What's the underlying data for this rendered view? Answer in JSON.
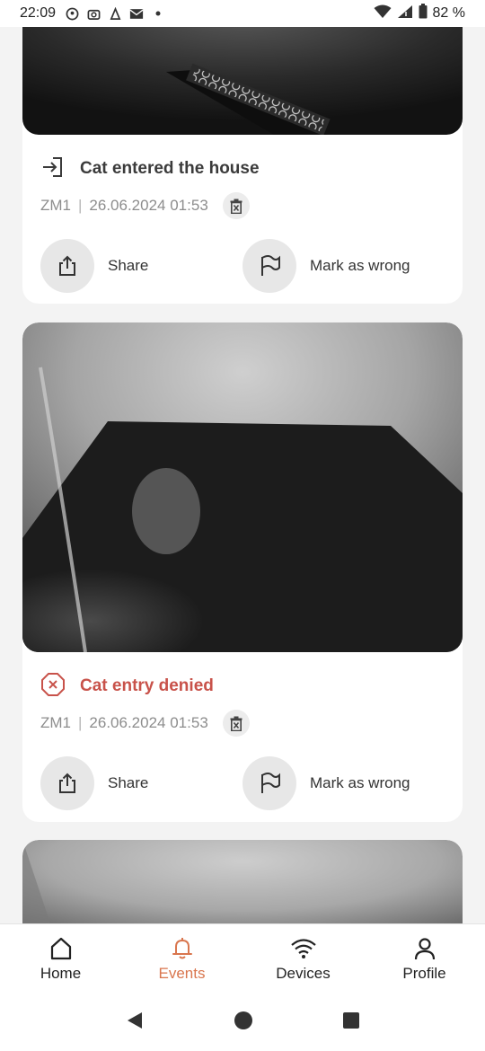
{
  "status_bar": {
    "time": "22:09",
    "battery": "82 %",
    "icons": [
      "location-icon",
      "camera-icon",
      "app-icon",
      "mail-icon",
      "dot-icon",
      "wifi-icon",
      "signal-icon",
      "battery-icon"
    ]
  },
  "events": [
    {
      "title": "Cat entered the house",
      "type": "entered",
      "device": "ZM1",
      "separator": "|",
      "datetime": "26.06.2024 01:53",
      "share_label": "Share",
      "mark_label": "Mark as wrong"
    },
    {
      "title": "Cat entry denied",
      "type": "denied",
      "device": "ZM1",
      "separator": "|",
      "datetime": "26.06.2024 01:53",
      "share_label": "Share",
      "mark_label": "Mark as wrong"
    }
  ],
  "bottom_nav": {
    "items": [
      {
        "label": "Home",
        "icon": "home-icon"
      },
      {
        "label": "Events",
        "icon": "bell-icon",
        "active": true
      },
      {
        "label": "Devices",
        "icon": "wifi-icon"
      },
      {
        "label": "Profile",
        "icon": "person-icon"
      }
    ]
  },
  "colors": {
    "accent": "#d9764e",
    "denied": "#c8524a",
    "background": "#f3f3f3"
  }
}
